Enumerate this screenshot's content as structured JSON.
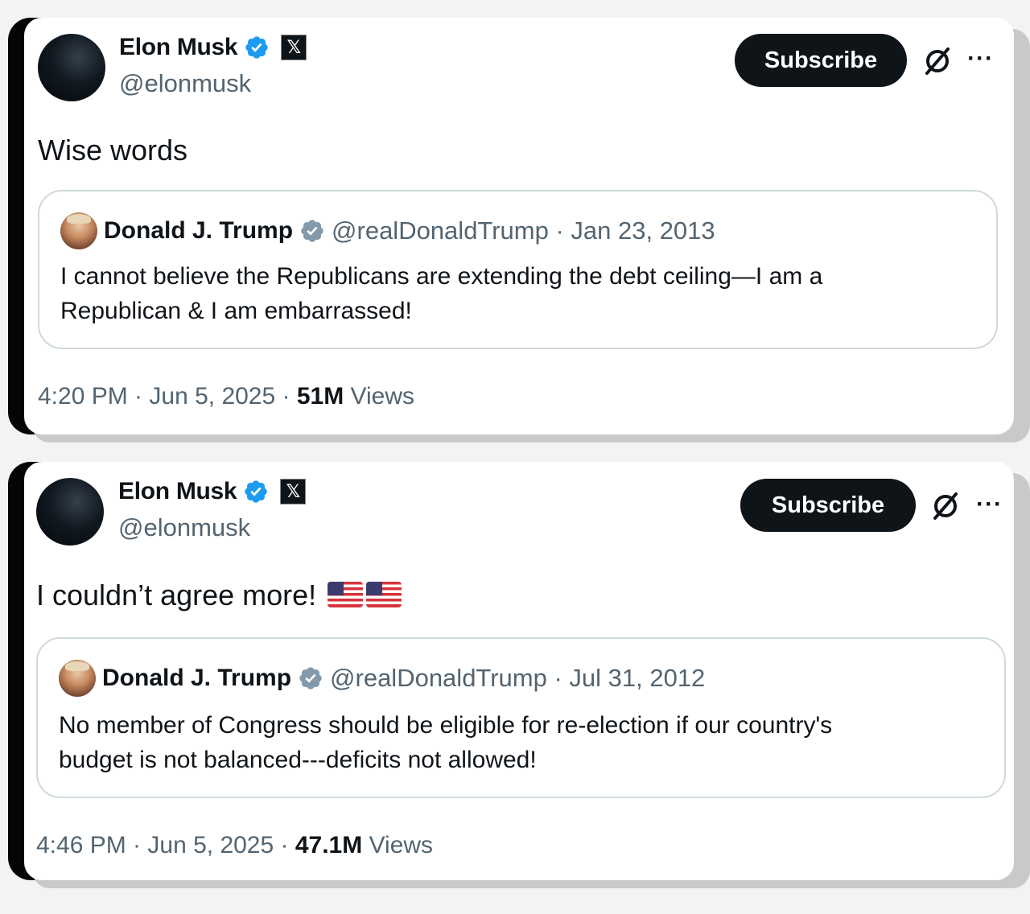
{
  "posts": [
    {
      "author": {
        "name": "Elon Musk",
        "handle": "@elonmusk",
        "affiliate_badge": "𝕏"
      },
      "subscribe_label": "Subscribe",
      "more_label": "···",
      "text": "Wise words",
      "flags": [],
      "quote": {
        "author": "Donald J. Trump",
        "handle_date": "@realDonaldTrump · Jan 23, 2013",
        "text_line1": "I cannot believe the Republicans are extending the debt ceiling—I am a",
        "text_line2": "Republican & I am embarrassed!"
      },
      "meta": {
        "time_date": "4:20 PM · Jun 5, 2025 · ",
        "views_count": "51M",
        "views_label": " Views"
      }
    },
    {
      "author": {
        "name": "Elon Musk",
        "handle": "@elonmusk",
        "affiliate_badge": "𝕏"
      },
      "subscribe_label": "Subscribe",
      "more_label": "···",
      "text": "I couldn’t agree more!",
      "flags": [
        "us-flag-emoji",
        "us-flag-emoji"
      ],
      "quote": {
        "author": "Donald J. Trump",
        "handle_date": "@realDonaldTrump · Jul 31, 2012",
        "text_line1": "No member of Congress should be eligible for re-election if our country's",
        "text_line2": "budget is not balanced---deficits not allowed!"
      },
      "meta": {
        "time_date": "4:46 PM · Jun 5, 2025 · ",
        "views_count": "47.1M",
        "views_label": " Views"
      }
    }
  ],
  "colors": {
    "verified_blue": "#1d9bf0",
    "verified_gray": "#829aab",
    "text": "#0f1419",
    "secondary": "#536471",
    "border": "#cfd9de"
  }
}
